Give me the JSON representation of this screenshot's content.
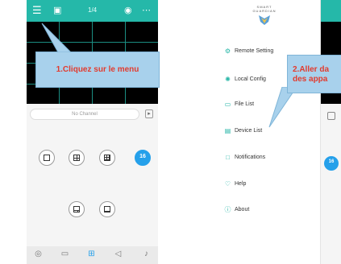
{
  "left_phone": {
    "topbar": {
      "counter": "1/4"
    },
    "channel_bar": {
      "label": "No Channel"
    },
    "layout_buttons": [
      {
        "name": "layout-1",
        "active": false
      },
      {
        "name": "layout-4",
        "active": false
      },
      {
        "name": "layout-9",
        "active": false
      },
      {
        "name": "layout-16",
        "active": true,
        "label": "16"
      },
      {
        "name": "layout-6",
        "active": false
      },
      {
        "name": "layout-8",
        "active": false
      }
    ]
  },
  "callout_left": {
    "text": "1.Cliquez sur le menu"
  },
  "right_phone": {
    "brand": {
      "text_top": "SMART",
      "text_bottom": "GUARDIAN"
    },
    "menu": [
      {
        "label": "Remote Setting",
        "icon": "gear-icon"
      },
      {
        "label": "Local Config",
        "icon": "settings-icon"
      },
      {
        "label": "File List",
        "icon": "folder-icon"
      },
      {
        "label": "Device List",
        "icon": "device-icon"
      },
      {
        "label": "Notifications",
        "icon": "notification-icon"
      },
      {
        "label": "Help",
        "icon": "help-icon"
      },
      {
        "label": "About",
        "icon": "info-icon"
      }
    ],
    "behind_badge": "16"
  },
  "callout_right": {
    "line1": "2.Aller da",
    "line2": "des appa"
  },
  "colors": {
    "teal": "#25b8a9",
    "callout": "#a8d1ec",
    "callout_text": "#e23b2e",
    "active_blue": "#25a0ea"
  }
}
